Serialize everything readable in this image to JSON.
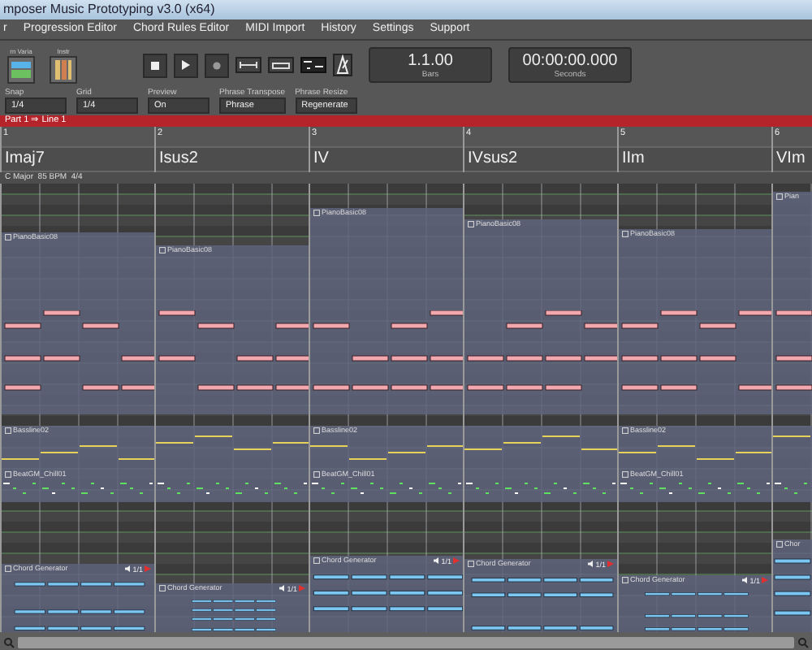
{
  "window": {
    "title": "mposer Music Prototyping v3.0 (x64)"
  },
  "menu": [
    "r",
    "Progression Editor",
    "Chord Rules Editor",
    "MIDI Import",
    "History",
    "Settings",
    "Support"
  ],
  "toolbar": {
    "tools": [
      {
        "label": "rn Varia"
      },
      {
        "label": "Instr"
      }
    ],
    "position": {
      "value": "1.1.00",
      "unit": "Bars"
    },
    "time": {
      "value": "00:00:00.000",
      "unit": "Seconds"
    }
  },
  "options": [
    {
      "label": "Snap",
      "value": "1/4"
    },
    {
      "label": "Grid",
      "value": "1/4"
    },
    {
      "label": "Preview",
      "value": "On"
    },
    {
      "label": "Phrase Transpose",
      "value": "Phrase"
    },
    {
      "label": "Phrase Resize",
      "value": "Regenerate"
    }
  ],
  "part_bar": {
    "title": "Part 1 ⇒ Line 1"
  },
  "song": {
    "key": "C Major",
    "tempo": "85 BPM",
    "meter": "4/4"
  },
  "bars": [
    {
      "number": "1",
      "chord": "Imaj7",
      "piano_clip": "PianoBasic08",
      "bass_clip": "Bassline02",
      "beat_clip": "BeatGM_Chill01",
      "chord_clip": "Chord Generator",
      "chord_clip_count": "1/1"
    },
    {
      "number": "2",
      "chord": "Isus2",
      "piano_clip": "PianoBasic08",
      "chord_clip": "Chord Generator",
      "chord_clip_count": "1/1"
    },
    {
      "number": "3",
      "chord": "IV",
      "piano_clip": "PianoBasic08",
      "bass_clip": "Bassline02",
      "beat_clip": "BeatGM_Chill01",
      "chord_clip": "Chord Generator",
      "chord_clip_count": "1/1"
    },
    {
      "number": "4",
      "chord": "IVsus2",
      "piano_clip": "PianoBasic08",
      "chord_clip": "Chord Generator",
      "chord_clip_count": "1/1"
    },
    {
      "number": "5",
      "chord": "IIm",
      "piano_clip": "PianoBasic08",
      "bass_clip": "Bassline02",
      "beat_clip": "BeatGM_Chill01",
      "chord_clip": "Chord Generator",
      "chord_clip_count": "1/1"
    },
    {
      "number": "6",
      "chord": "VIm",
      "piano_clip": "Pian",
      "chord_clip": "Chor"
    }
  ]
}
